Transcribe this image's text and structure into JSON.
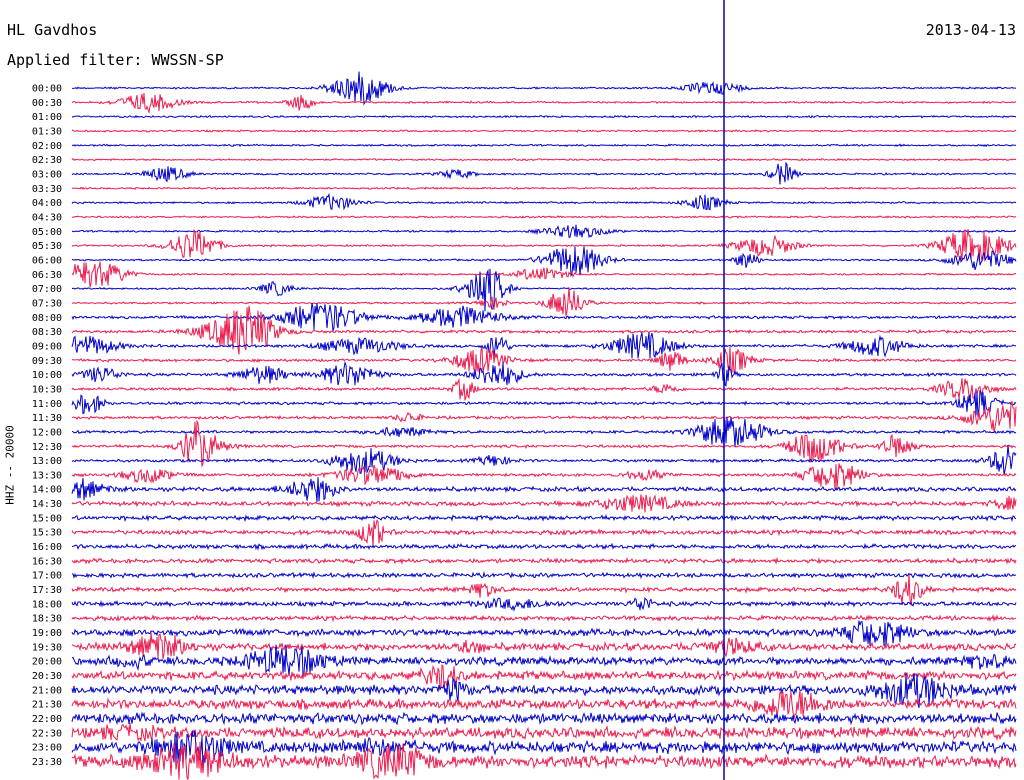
{
  "header": {
    "station": "HL Gavdhos",
    "filter": "Applied filter: WWSSN-SP",
    "date": "2013-04-13"
  },
  "chart_data": {
    "type": "line",
    "title": "HL Gavdhos",
    "subtitle": "Applied filter: WWSSN-SP",
    "date": "2013-04-13",
    "ylabel": "HHZ -- 20000",
    "row_labels": [
      "00:00",
      "00:30",
      "01:00",
      "01:30",
      "02:00",
      "02:30",
      "03:00",
      "03:30",
      "04:00",
      "04:30",
      "05:00",
      "05:30",
      "06:00",
      "06:30",
      "07:00",
      "07:30",
      "08:00",
      "08:30",
      "09:00",
      "09:30",
      "10:00",
      "10:30",
      "11:00",
      "11:30",
      "12:00",
      "12:30",
      "13:00",
      "13:30",
      "14:00",
      "14:30",
      "15:00",
      "15:30",
      "16:00",
      "16:30",
      "17:00",
      "17:30",
      "18:00",
      "18:30",
      "19:00",
      "19:30",
      "20:00",
      "20:30",
      "21:00",
      "21:30",
      "22:00",
      "22:30",
      "23:00",
      "23:30"
    ],
    "colors": [
      "#0000cc",
      "#ee1c4e"
    ],
    "grid": false
  }
}
